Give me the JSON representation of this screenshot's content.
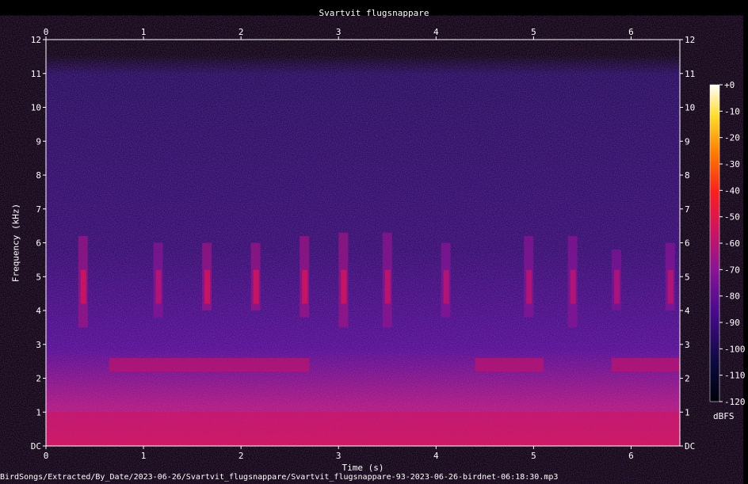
{
  "chart_data": {
    "type": "heatmap",
    "title": "Svartvit flugsnappare",
    "xlabel": "Time (s)",
    "ylabel": "Frequency (kHz)",
    "xlim": [
      0,
      6.5
    ],
    "ylim": [
      0,
      12
    ],
    "x_ticks": [
      "0",
      "1",
      "2",
      "3",
      "4",
      "5",
      "6"
    ],
    "y_ticks": [
      "DC",
      "1",
      "2",
      "3",
      "4",
      "5",
      "6",
      "7",
      "8",
      "9",
      "10",
      "11",
      "12"
    ],
    "colorbar": {
      "unit": "dBFS",
      "range": [
        -120,
        0
      ],
      "ticks": [
        "+0",
        "-10",
        "-20",
        "-30",
        "-40",
        "-50",
        "-60",
        "-70",
        "-80",
        "-90",
        "-100",
        "-110",
        "-120"
      ]
    },
    "description_values": {
      "background_level_dbfs": -95,
      "low_freq_band_khz": [
        0,
        1
      ],
      "low_freq_level_dbfs": -55
    },
    "song_phrases": [
      {
        "time": 0.38,
        "freq_low": 3.5,
        "freq_high": 6.2,
        "level": -55
      },
      {
        "time": 1.15,
        "freq_low": 3.8,
        "freq_high": 6.0,
        "level": -60
      },
      {
        "time": 1.65,
        "freq_low": 4.0,
        "freq_high": 6.0,
        "level": -55
      },
      {
        "time": 2.15,
        "freq_low": 4.0,
        "freq_high": 6.0,
        "level": -55
      },
      {
        "time": 2.65,
        "freq_low": 3.8,
        "freq_high": 6.2,
        "level": -55
      },
      {
        "time": 3.05,
        "freq_low": 3.5,
        "freq_high": 6.3,
        "level": -55
      },
      {
        "time": 3.5,
        "freq_low": 3.5,
        "freq_high": 6.3,
        "level": -58
      },
      {
        "time": 4.1,
        "freq_low": 3.8,
        "freq_high": 6.0,
        "level": -60
      },
      {
        "time": 4.95,
        "freq_low": 3.8,
        "freq_high": 6.2,
        "level": -60
      },
      {
        "time": 5.4,
        "freq_low": 3.5,
        "freq_high": 6.2,
        "level": -60
      },
      {
        "time": 5.85,
        "freq_low": 4.0,
        "freq_high": 5.8,
        "level": -62
      },
      {
        "time": 6.4,
        "freq_low": 4.0,
        "freq_high": 6.0,
        "level": -60
      }
    ],
    "harmonic_band": {
      "freq_low": 2.2,
      "freq_high": 2.6,
      "segments": [
        [
          0.65,
          2.7
        ],
        [
          4.4,
          5.1
        ],
        [
          5.8,
          6.5
        ]
      ],
      "level": -60
    }
  },
  "footer": {
    "file_path": "BirdSongs/Extracted/By_Date/2023-06-26/Svartvit_flugsnappare/Svartvit_flugsnappare-93-2023-06-26-birdnet-06:18:30.mp3"
  }
}
